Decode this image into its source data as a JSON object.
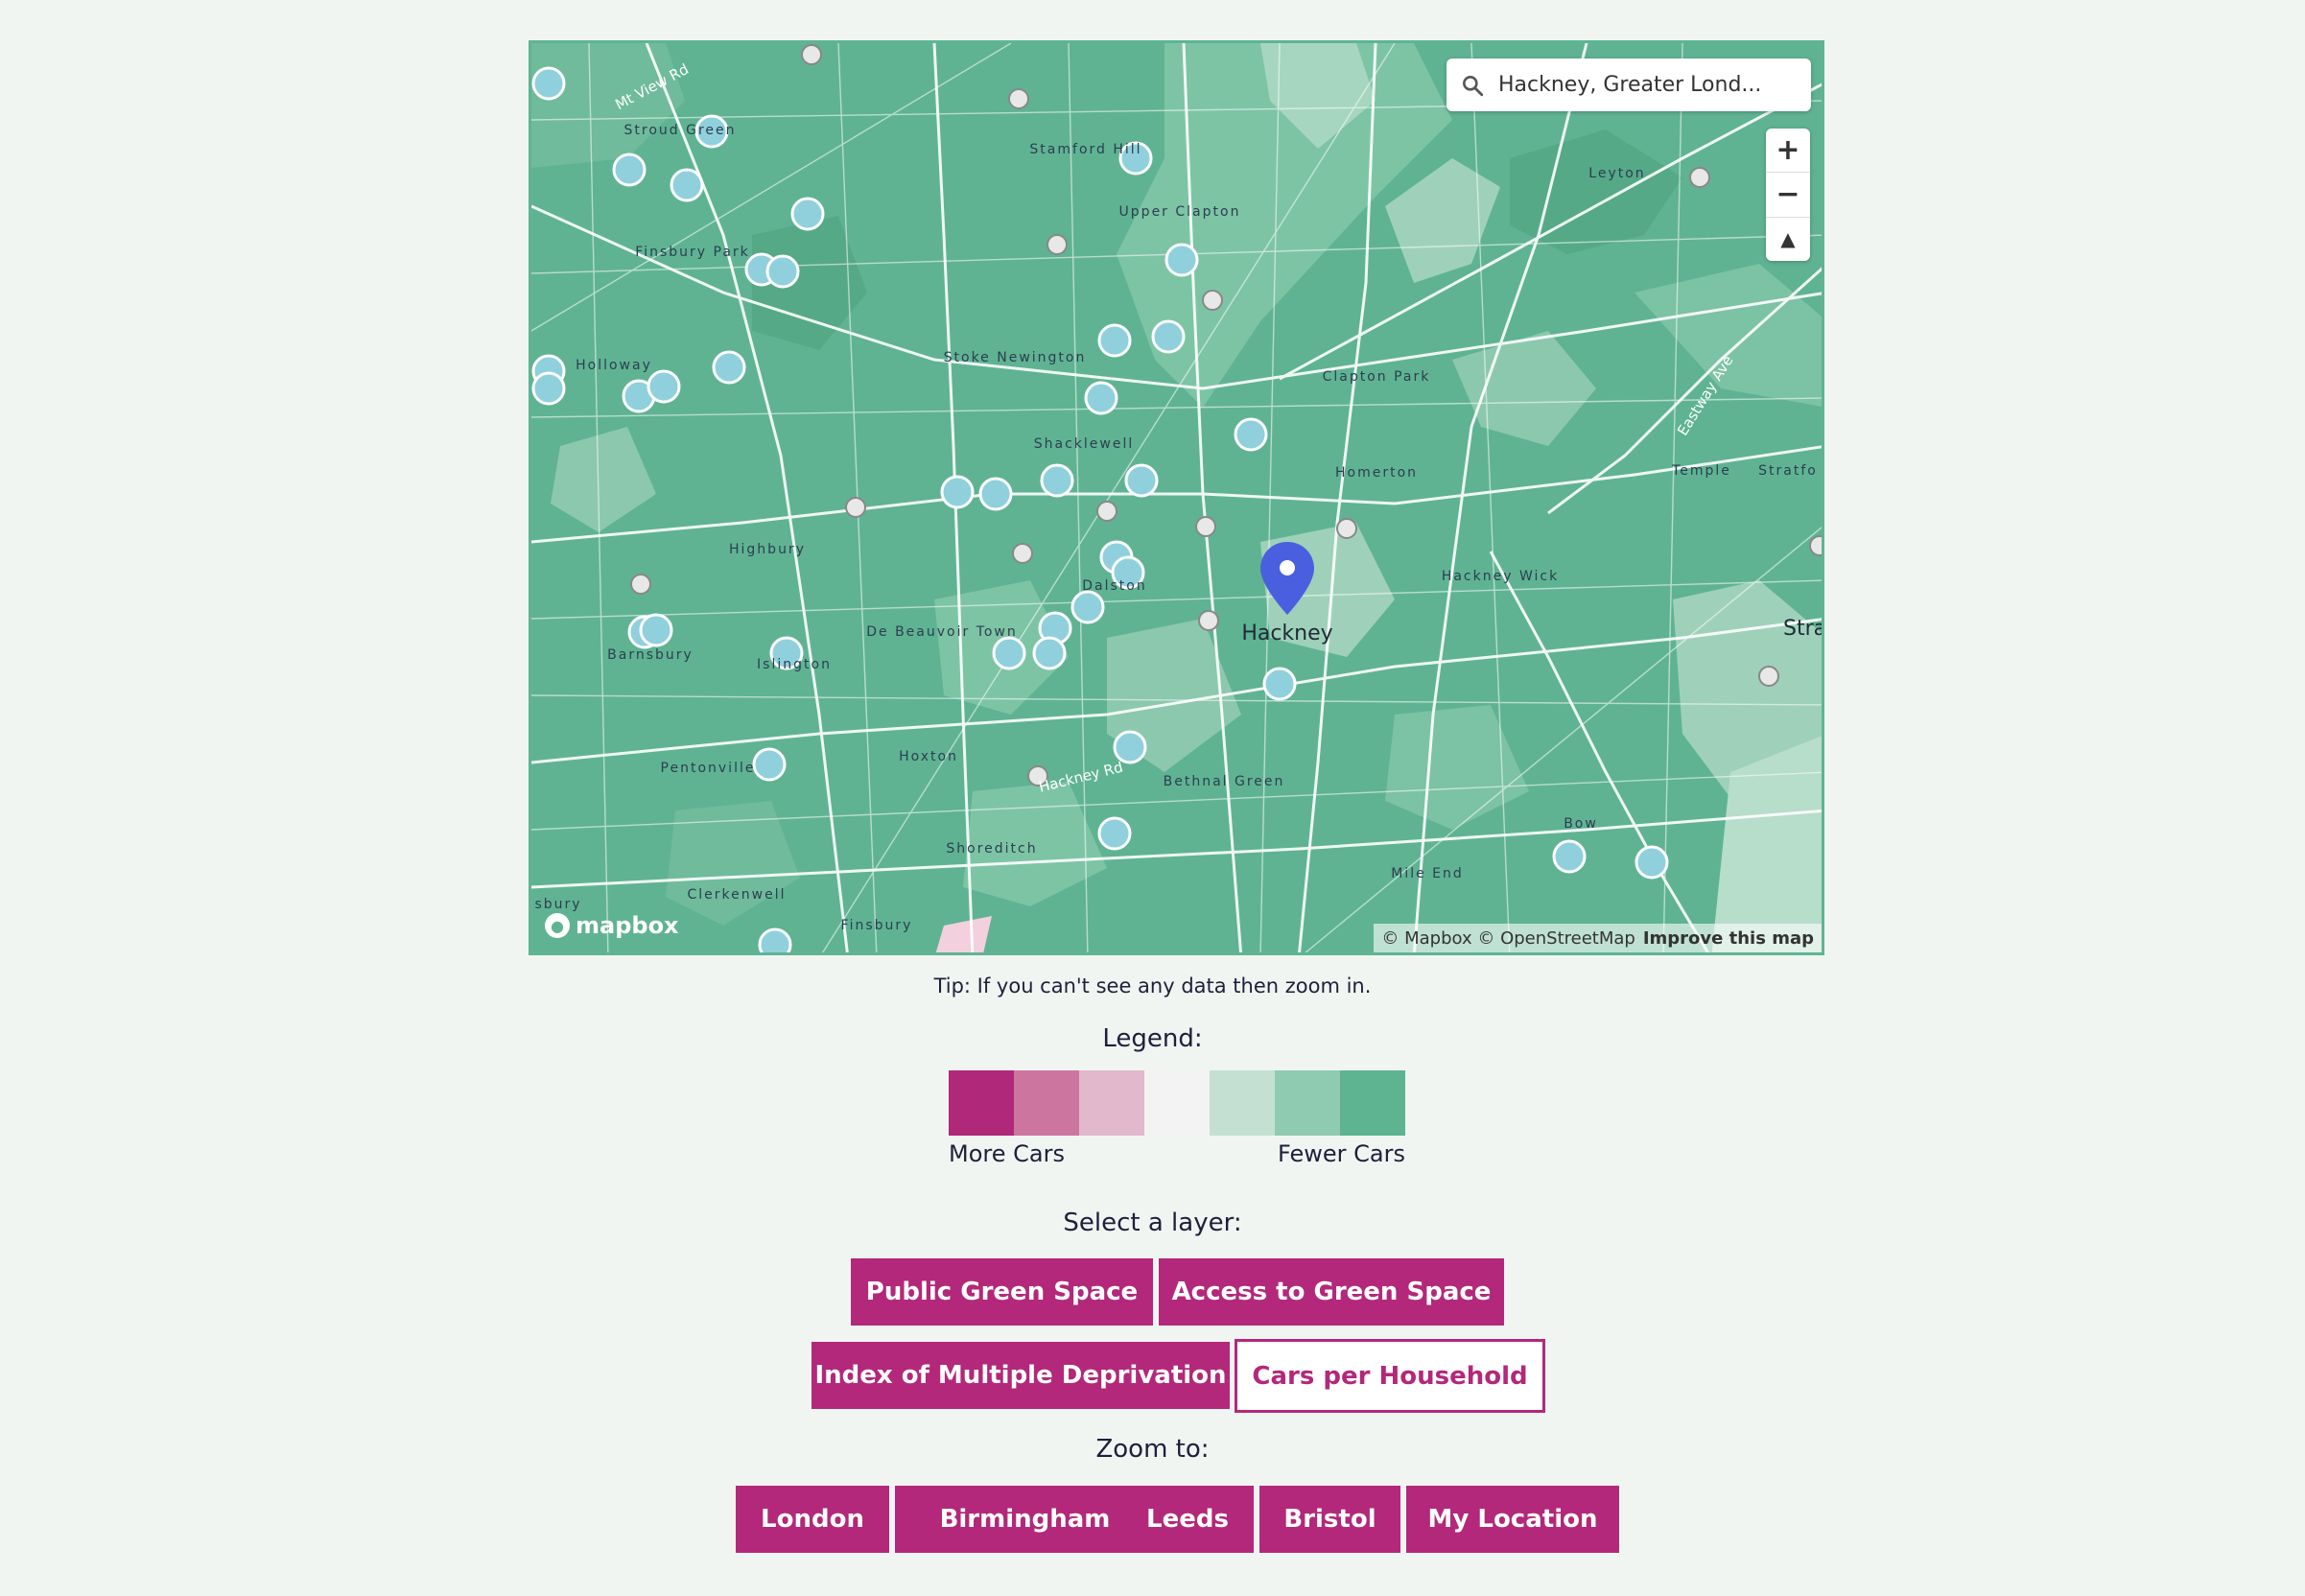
{
  "map": {
    "search": {
      "value": "Hackney, Greater Lond...",
      "icon": "search-icon"
    },
    "zoom_in": "+",
    "zoom_out": "−",
    "compass": "▲",
    "marker_label": "Hackney",
    "place_labels": [
      "Stroud Green",
      "Stamford Hill",
      "Upper Clapton",
      "Finsbury Park",
      "Leyton",
      "Holloway",
      "Stoke Newington",
      "Clapton Park",
      "Shacklewell",
      "Homerton",
      "Temple",
      "Stratfo",
      "Highbury",
      "Dalston",
      "Hackney Wick",
      "Stratford",
      "Barnsbury",
      "Islington",
      "De Beauvoir Town",
      "Pentonville",
      "Hoxton",
      "Hackney Rd",
      "Bethnal Green",
      "Shoreditch",
      "Bow",
      "Clerkenwell",
      "Finsbury",
      "Mile End",
      "sbury",
      "Mt View Rd",
      "Eastway Ave"
    ],
    "attribution": "© Mapbox © OpenStreetMap",
    "improve": "Improve this map",
    "logo": "mapbox"
  },
  "tip": "Tip: If you can't see any data then zoom in.",
  "legend": {
    "title": "Legend:",
    "colors": [
      "#b0287a",
      "#cc769f",
      "#e2b8cc",
      "#f3f3f3",
      "#c3e0d3",
      "#8fcbb1",
      "#5eb391"
    ],
    "low_label": "More Cars",
    "high_label": "Fewer Cars"
  },
  "layers": {
    "title": "Select a layer:",
    "items": [
      {
        "label": "Public Green Space",
        "active": false
      },
      {
        "label": "Access to Green Space",
        "active": false
      },
      {
        "label": "Index of Multiple Deprivation",
        "active": false
      },
      {
        "label": "Cars per Household",
        "active": true
      }
    ]
  },
  "zoom_to": {
    "title": "Zoom to:",
    "items": [
      "London",
      "Birmingham",
      "Leeds",
      "Bristol",
      "My Location"
    ]
  },
  "colors": {
    "accent": "#b3287a",
    "map_green": "#5fb393",
    "marker_blue": "#4a5fe0"
  }
}
